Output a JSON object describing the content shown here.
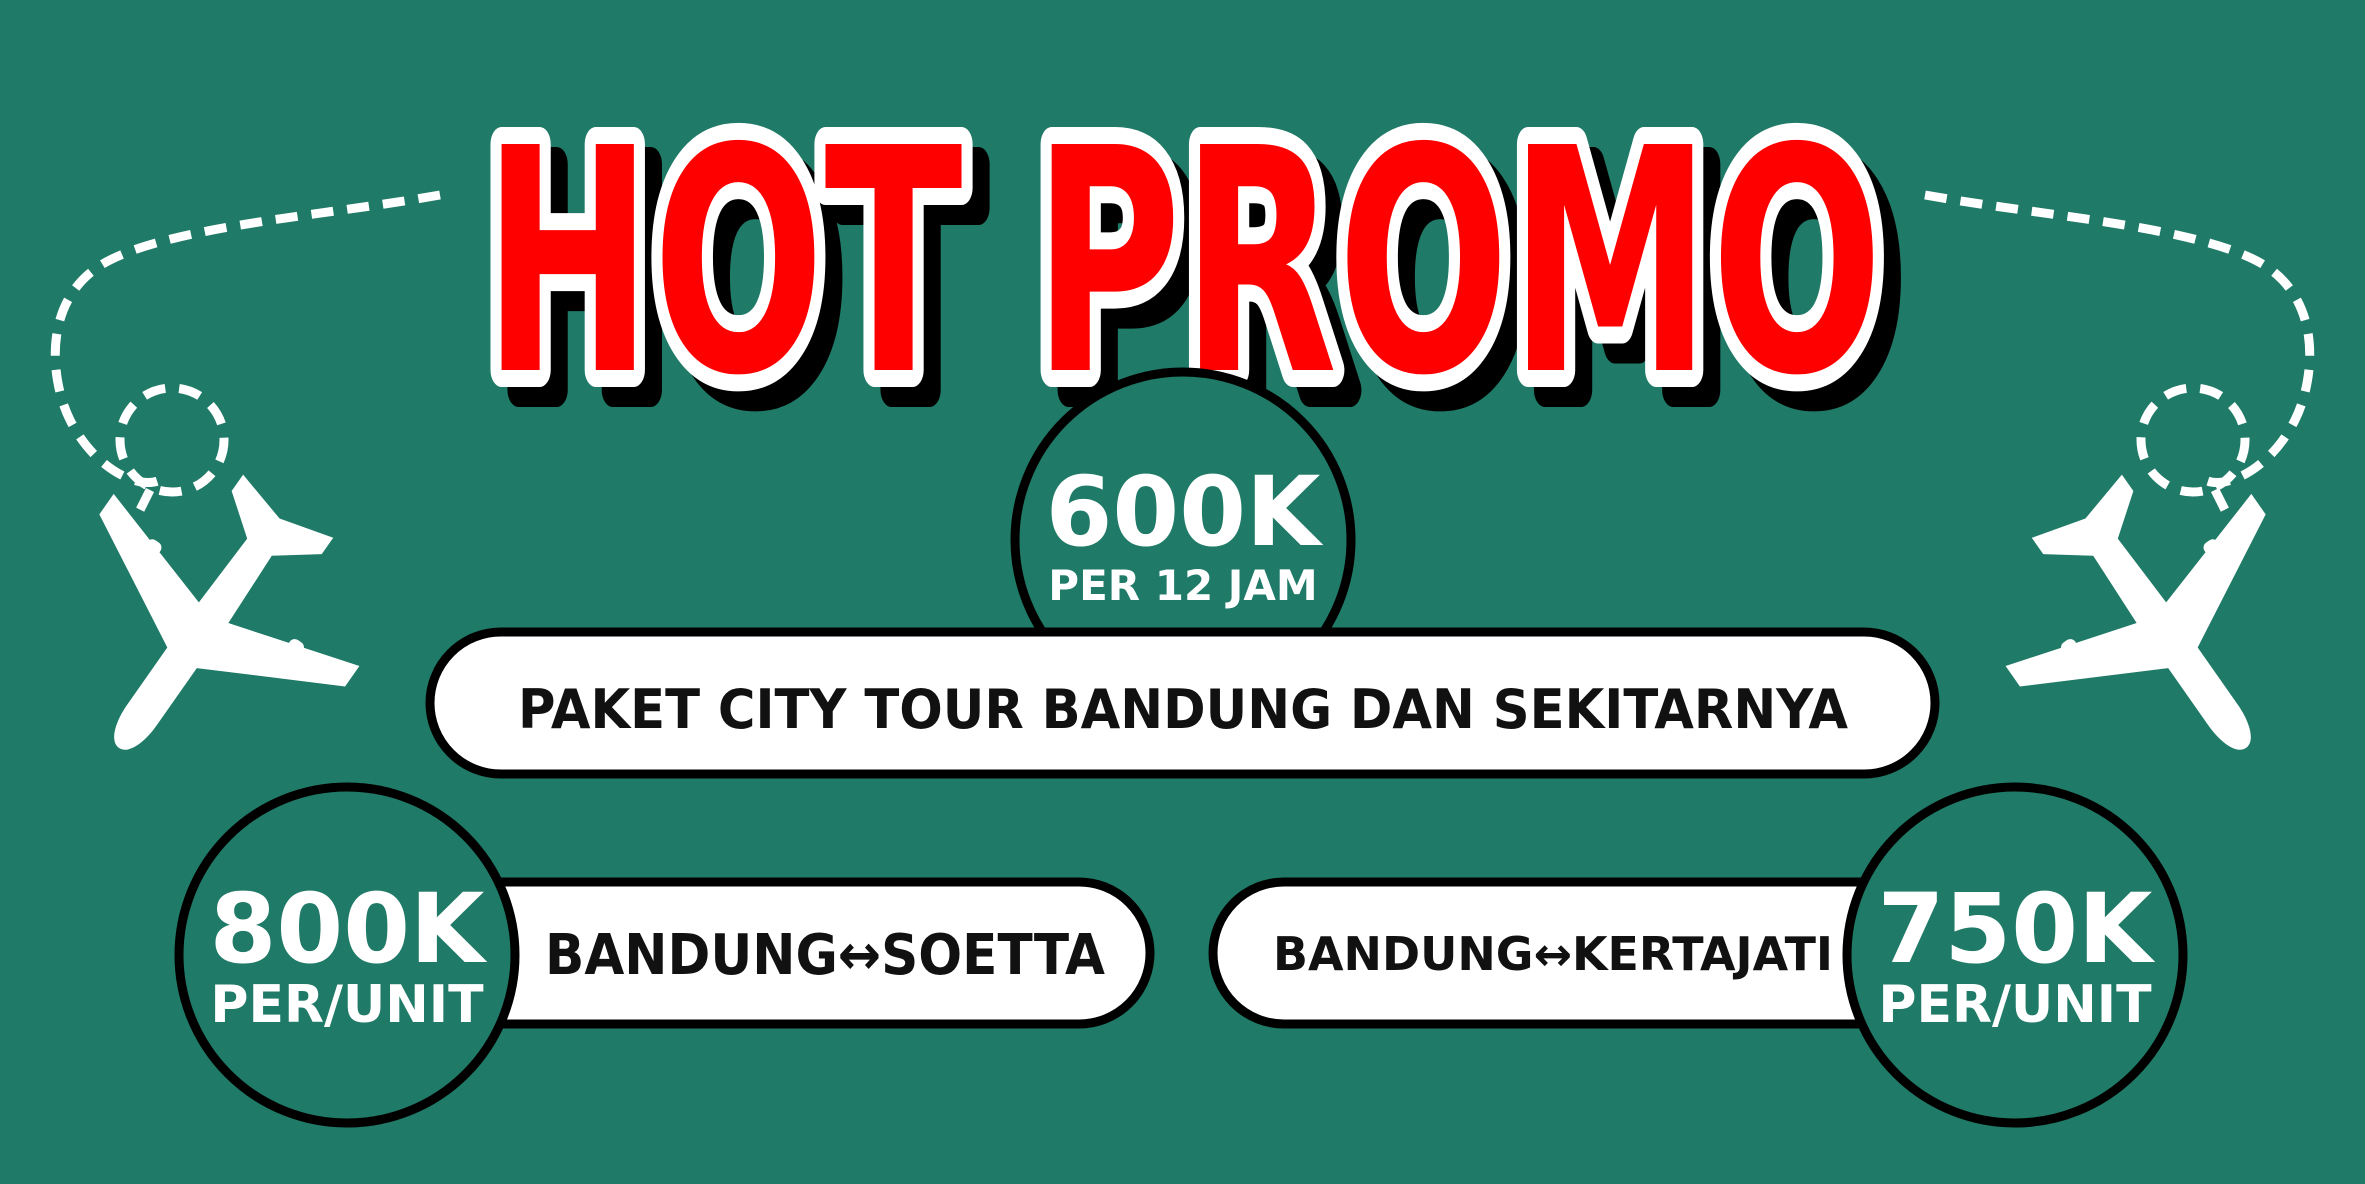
{
  "colors": {
    "background": "#1f7a67",
    "title_fill": "#ff0000",
    "title_outline": "#ffffff",
    "shadow": "#000000",
    "pill_fill": "#ffffff",
    "circle_fill": "#1f7a67",
    "text_dark": "#111111",
    "text_light": "#ffffff"
  },
  "title": {
    "word1": "HOT",
    "word2": "PROMO"
  },
  "city_tour": {
    "price": "600K",
    "unit": "PER 12 JAM",
    "label": "PAKET CITY TOUR BANDUNG DAN SEKITARNYA"
  },
  "route_left": {
    "price": "800K",
    "unit": "PER/UNIT",
    "label": "BANDUNG↔SOETTA"
  },
  "route_right": {
    "price": "750K",
    "unit": "PER/UNIT",
    "label": "BANDUNG↔KERTAJATI"
  },
  "icons": {
    "left_plane": "airplane-icon",
    "right_plane": "airplane-icon",
    "left_trail": "dashed-flight-path",
    "right_trail": "dashed-flight-path"
  }
}
